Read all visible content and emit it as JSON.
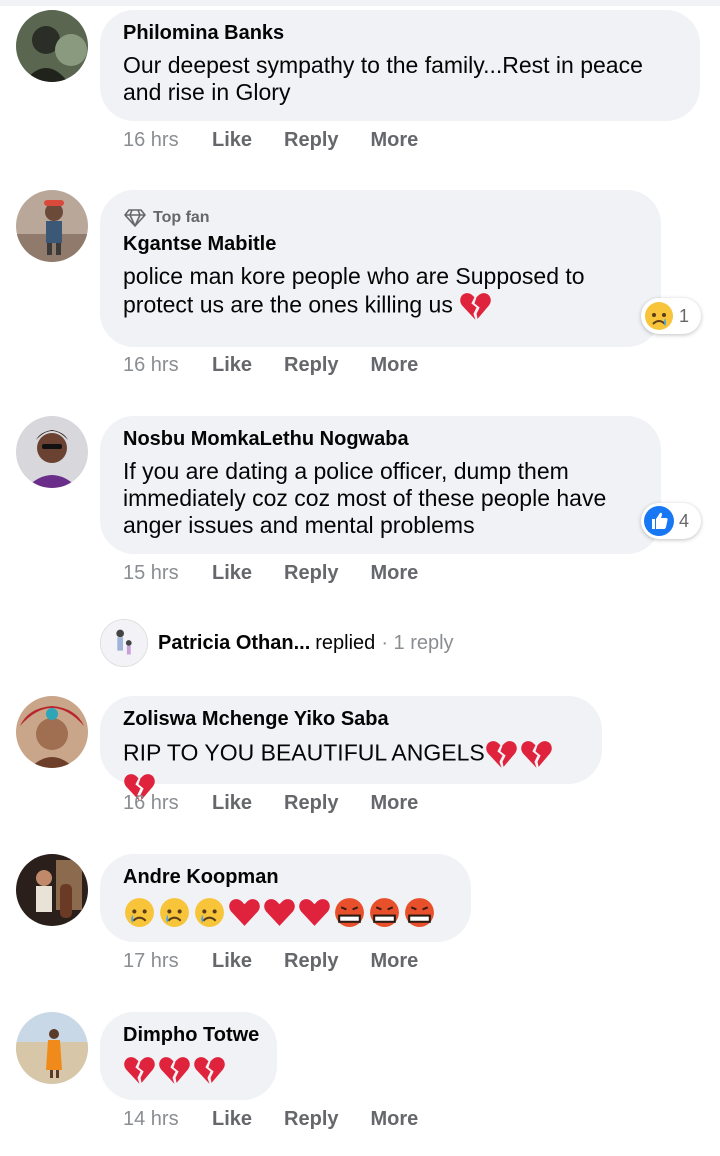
{
  "comments": [
    {
      "name": "Philomina Banks",
      "badge": "",
      "text": "Our deepest sympathy to the family...Rest in peace\nand rise in Glory",
      "time": "16 hrs",
      "emojis": [],
      "reaction": null
    },
    {
      "name": "Kgantse Mabitle",
      "badge": "Top fan",
      "text": "police man kore people who are Supposed to\nprotect us are the ones killing us",
      "time": "16 hrs",
      "emojis": [
        "broken-heart"
      ],
      "reaction": {
        "icon": "sad-face-icon",
        "count": "1"
      }
    },
    {
      "name": "Nosbu MomkaLethu Nogwaba",
      "badge": "",
      "text": "If you are dating a police officer, dump them\nimmediately coz coz most of these people have\nanger issues and mental problems",
      "time": "15 hrs",
      "emojis": [],
      "reaction": {
        "icon": "like-icon",
        "count": "4"
      }
    },
    {
      "name": "Zoliswa Mchenge Yiko Saba",
      "badge": "",
      "text": "RIP TO YOU BEAUTIFUL ANGELS",
      "time": "16 hrs",
      "emojis": [
        "broken-heart",
        "broken-heart",
        "broken-heart"
      ],
      "reaction": null
    },
    {
      "name": "Andre Koopman",
      "badge": "",
      "text": "",
      "time": "17 hrs",
      "emojis": [
        "crying-face",
        "crying-face",
        "crying-face",
        "red-heart",
        "red-heart",
        "red-heart",
        "cursing-face",
        "cursing-face",
        "cursing-face"
      ],
      "reaction": null
    },
    {
      "name": "Dimpho Totwe",
      "badge": "",
      "text": "",
      "time": "14 hrs",
      "emojis": [
        "broken-heart",
        "broken-heart",
        "broken-heart"
      ],
      "reaction": null
    }
  ],
  "actions": {
    "like": "Like",
    "reply": "Reply",
    "more": "More"
  },
  "reply_thread": {
    "name": "Patricia Othan...",
    "verb": "replied",
    "count": "· 1 reply"
  },
  "colors": {
    "bubble": "#f0f2f5",
    "secondary_text": "#65676b",
    "like_blue": "#1877f2"
  }
}
